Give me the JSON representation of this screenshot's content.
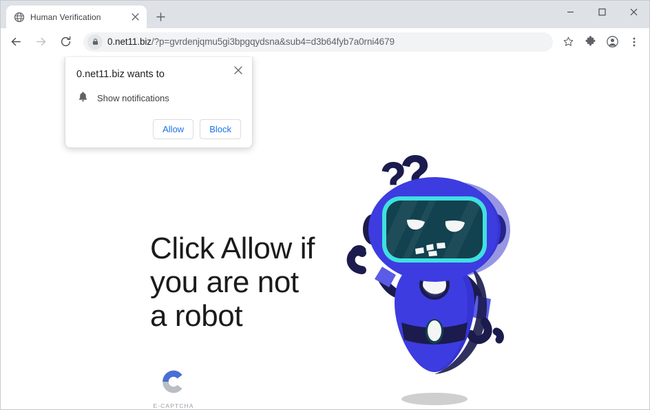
{
  "browser": {
    "tab": {
      "title": "Human Verification",
      "favicon": "globe-icon",
      "close_label": "×"
    },
    "new_tab_label": "+",
    "window_controls": {
      "minimize": "minimize-icon",
      "maximize": "maximize-icon",
      "close": "close-icon"
    },
    "toolbar": {
      "back": "back-arrow-icon",
      "forward": "forward-arrow-icon",
      "reload": "reload-icon",
      "lock": "lock-icon",
      "url_host": "0.net11.biz",
      "url_path": "/?p=gvrdenjqmu5gi3bpgqydsna&sub4=d3b64fyb7a0rni4679",
      "url_full": "0.net11.biz/?p=gvrdenjqmu5gi3bpgqydsna&sub4=d3b64fyb7a0rni4679",
      "bookmark": "star-icon",
      "extensions": "puzzle-piece-icon",
      "profile": "profile-avatar-icon",
      "menu": "three-dot-menu-icon"
    }
  },
  "permission_dialog": {
    "title": "0.net11.biz wants to",
    "permission_icon": "bell-icon",
    "permission_label": "Show notifications",
    "allow_label": "Allow",
    "block_label": "Block",
    "close_label": "×",
    "accent_color": "#1a73e8"
  },
  "page": {
    "headline": "Click Allow if you are not a robot",
    "captcha": {
      "mark": "c-logo-icon",
      "label": "E-CAPTCHA",
      "blue": "#4a6fd4",
      "gray": "#b9bec5"
    },
    "robot": {
      "name": "confused-robot-illustration",
      "thought": "??",
      "body_color": "#3d3ce0",
      "dark_color": "#1b1b4d",
      "visor_border": "#3fe0e0",
      "visor_fill": "#12414f"
    }
  }
}
